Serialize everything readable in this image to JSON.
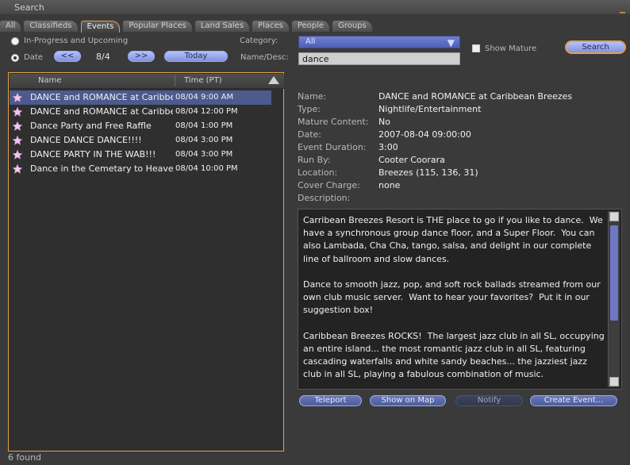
{
  "window": {
    "title": "Search"
  },
  "tabs": [
    {
      "label": "All"
    },
    {
      "label": "Classifieds"
    },
    {
      "label": "Events",
      "active": true
    },
    {
      "label": "Popular Places"
    },
    {
      "label": "Land Sales"
    },
    {
      "label": "Places"
    },
    {
      "label": "People"
    },
    {
      "label": "Groups"
    }
  ],
  "filters": {
    "in_progress_label": "In-Progress and Upcoming",
    "date_label": "Date",
    "prev_label": "<<",
    "date_value": "8/4",
    "next_label": ">>",
    "today_label": "Today",
    "category_label": "Category:",
    "category_value": "All",
    "namedesc_label": "Name/Desc:",
    "namedesc_value": "dance",
    "show_mature_label": "Show Mature",
    "search_label": "Search",
    "selected_radio": "date",
    "show_mature_checked": false
  },
  "results": {
    "columns": [
      "Name",
      "Time (PT)"
    ],
    "rows": [
      {
        "name": "DANCE and ROMANCE at Caribbean Breezes",
        "time": "08/04 9:00 AM",
        "selected": true
      },
      {
        "name": "DANCE and ROMANCE at Caribbean Breezes",
        "time": "08/04 12:00 PM",
        "selected": false
      },
      {
        "name": "Dance Party and Free Raffle",
        "time": "08/04 1:00 PM",
        "selected": false
      },
      {
        "name": "DANCE DANCE DANCE!!!!",
        "time": "08/04 3:00 PM",
        "selected": false
      },
      {
        "name": "DANCE PARTY IN THE WAB!!!",
        "time": "08/04 3:00 PM",
        "selected": false
      },
      {
        "name": "Dance in the Cemetary to Heavenly Music",
        "time": "08/04 10:00 PM",
        "selected": false
      }
    ],
    "count_text": "6 found"
  },
  "details": {
    "fields": [
      {
        "key": "Name:",
        "value": "DANCE and ROMANCE at Caribbean Breezes"
      },
      {
        "key": "Type:",
        "value": "Nightlife/Entertainment"
      },
      {
        "key": "Mature Content:",
        "value": "No"
      },
      {
        "key": "Date:",
        "value": "2007-08-04 09:00:00"
      },
      {
        "key": "Event Duration:",
        "value": "3:00"
      },
      {
        "key": "Run By:",
        "value": "Cooter Coorara"
      },
      {
        "key": "Location:",
        "value": "Breezes (115, 136, 31)"
      },
      {
        "key": "Cover Charge:",
        "value": "none"
      },
      {
        "key": "Description:",
        "value": ""
      }
    ],
    "description": "Carribean Breezes Resort is THE place to go if you like to dance.  We have a synchronous group dance floor, and a Super Floor.  You can also Lambada, Cha Cha, tango, salsa, and delight in our complete line of ballroom and slow dances.\n\nDance to smooth jazz, pop, and soft rock ballads streamed from our own club music server.  Want to hear your favorites?  Put it in our suggestion box!\n\nCaribbean Breezes ROCKS!  The largest jazz club in all SL, occupying an entire island... the most romantic jazz club in all SL, featuring cascading waterfalls and white sandy beaches... the jazziest jazz club in all SL, playing a fabulous combination of music."
  },
  "actions": {
    "teleport": "Teleport",
    "show_on_map": "Show on Map",
    "notify": "Notify",
    "create_event": "Create Event..."
  },
  "colors": {
    "accent_orange": "#e3a24a",
    "selection_blue": "#4c5a8d",
    "button_blue": "#7f8ed8"
  },
  "icons": {
    "event_row": "star-icon",
    "window_close": "close-icon"
  }
}
